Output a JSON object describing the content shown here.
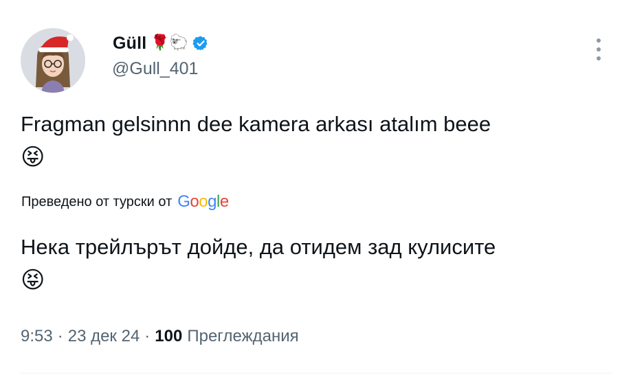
{
  "author": {
    "display_name": "Güll",
    "name_emojis": "🌹🐑",
    "handle": "@Gull_401",
    "verified": true,
    "avatar": "cartoon-avatar-santa-hat-icon"
  },
  "tweet": {
    "text": "Fragman gelsinnn dee kamera arkası atalım beee",
    "emoji": "😝"
  },
  "translation": {
    "note": "Преведено от турски от",
    "provider": [
      "G",
      "o",
      "o",
      "g",
      "l",
      "e"
    ],
    "provider_colors": [
      "#4285F4",
      "#EA4335",
      "#FBBC05",
      "#4285F4",
      "#34A853",
      "#EA4335"
    ],
    "text": "Нека трейлърът дойде, да отидем зад кулисите",
    "emoji": "😝"
  },
  "meta": {
    "time": "9:53",
    "date": "23 дек 24",
    "separator": "·",
    "views_count": "100",
    "views_label": "Преглеждания"
  },
  "colors": {
    "verified": "#1d9bf0",
    "secondary_text": "#536471",
    "primary_text": "#0f1419"
  },
  "icons": {
    "more": "more-vertical-icon",
    "verified": "verified-badge-icon"
  }
}
